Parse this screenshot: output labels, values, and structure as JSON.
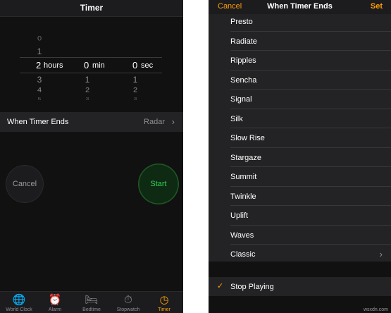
{
  "left": {
    "title": "Timer",
    "picker": {
      "hours": {
        "above": [
          "0",
          "1"
        ],
        "selected": "2",
        "unit": "hours",
        "below": [
          "3",
          "4",
          "5"
        ]
      },
      "minutes": {
        "selected": "0",
        "unit": "min",
        "below": [
          "1",
          "2",
          "3"
        ]
      },
      "seconds": {
        "selected": "0",
        "unit": "sec",
        "below": [
          "1",
          "2",
          "3"
        ]
      }
    },
    "when_timer_ends": {
      "label": "When Timer Ends",
      "value": "Radar"
    },
    "buttons": {
      "cancel": "Cancel",
      "start": "Start"
    },
    "tabs": [
      {
        "label": "World Clock",
        "icon": "globe-icon",
        "glyph": "🌐"
      },
      {
        "label": "Alarm",
        "icon": "alarm-clock-icon",
        "glyph": "⏰"
      },
      {
        "label": "Bedtime",
        "icon": "bed-icon",
        "glyph": "🛏"
      },
      {
        "label": "Stopwatch",
        "icon": "stopwatch-icon",
        "glyph": "⏱"
      },
      {
        "label": "Timer",
        "icon": "timer-icon",
        "glyph": "◷",
        "active": true
      }
    ]
  },
  "right": {
    "nav": {
      "cancel": "Cancel",
      "title": "When Timer Ends",
      "set": "Set"
    },
    "sounds": [
      "Presto",
      "Radiate",
      "Ripples",
      "Sencha",
      "Signal",
      "Silk",
      "Slow Rise",
      "Stargaze",
      "Summit",
      "Twinkle",
      "Uplift",
      "Waves",
      "Classic"
    ],
    "stop_playing": {
      "label": "Stop Playing",
      "checked": true
    }
  },
  "watermark": "wsxdn.com",
  "colors": {
    "accent": "#ff9f0a",
    "start_green": "#30d158",
    "background": "#111111",
    "row": "#232325"
  }
}
